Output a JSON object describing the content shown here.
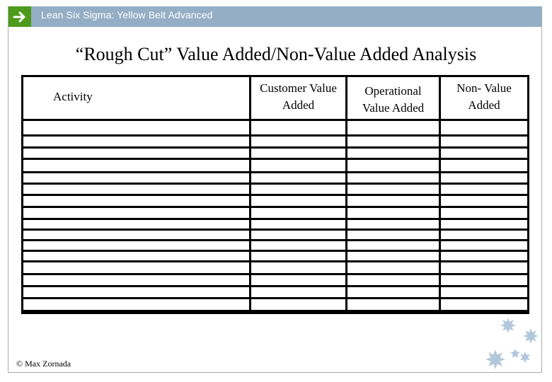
{
  "header": {
    "icon": "arrow-right-icon",
    "title": "Lean Six Sigma: Yellow Belt Advanced",
    "bar_color": "#94aec6",
    "icon_bg_color": "#4e9a1a"
  },
  "slide": {
    "title": "“Rough Cut” Value Added/Non-Value Added Analysis"
  },
  "table": {
    "columns": [
      {
        "line1": "Activity",
        "line2": ""
      },
      {
        "line1": "Customer Value",
        "line2": "Added"
      },
      {
        "line1": "Operational",
        "line2": "Value Added"
      },
      {
        "line1": "Non- Value",
        "line2": "Added"
      }
    ],
    "rows": [
      [
        "",
        "",
        "",
        ""
      ],
      [
        "",
        "",
        "",
        ""
      ],
      [
        "",
        "",
        "",
        ""
      ],
      [
        "",
        "",
        "",
        ""
      ],
      [
        "",
        "",
        "",
        ""
      ],
      [
        "",
        "",
        "",
        ""
      ],
      [
        "",
        "",
        "",
        ""
      ],
      [
        "",
        "",
        "",
        ""
      ],
      [
        "",
        "",
        "",
        ""
      ],
      [
        "",
        "",
        "",
        ""
      ],
      [
        "",
        "",
        "",
        ""
      ],
      [
        "",
        "",
        "",
        ""
      ],
      [
        "",
        "",
        "",
        ""
      ],
      [
        "",
        "",
        "",
        ""
      ],
      [
        "",
        "",
        "",
        ""
      ],
      [
        "",
        "",
        "",
        ""
      ],
      [
        "",
        "",
        "",
        ""
      ]
    ]
  },
  "footer": {
    "copyright": "© Max Zornada",
    "decoration": "stars-icon",
    "star_color": "#b4c8dc"
  }
}
